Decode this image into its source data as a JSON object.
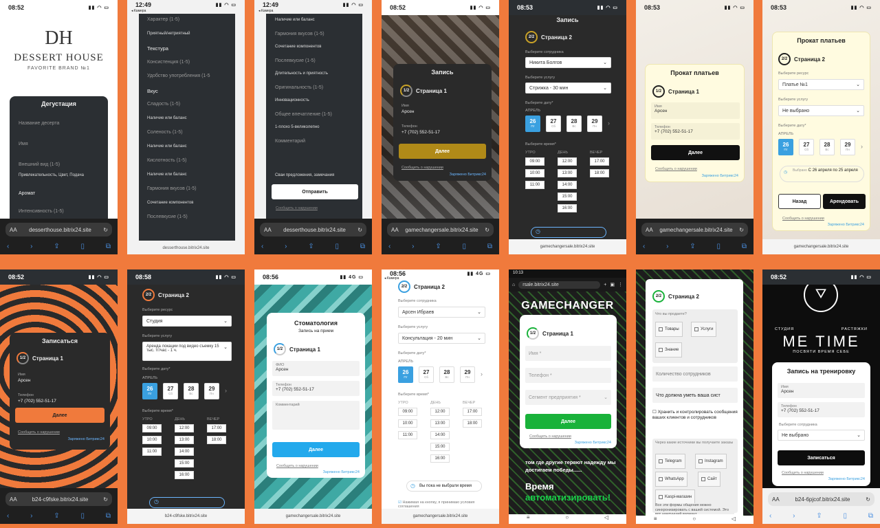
{
  "p1": {
    "time": "08:52",
    "logo_mono": "DH",
    "logo": "DESSERT HOUSE",
    "tag": "FAVORITE BRAND №1",
    "title": "Дегустация",
    "f1": "Название десерта",
    "f2": "Имя",
    "f3": "Внешний вид (1-5)",
    "f3s": "Привлекательность, Цвет, Подача",
    "f4": "Аромат",
    "f5": "Интенсивность (1-5)",
    "url": "desserthouse.bitrix24.site",
    "aa": "AA"
  },
  "p2": {
    "time": "12:49",
    "cam": "◂ Камера",
    "items": [
      "Характер (1-5)",
      "Приятный/нетриятный",
      "Текстура",
      "Консистенция (1-5)",
      "Удобство употребления (1-5",
      "Вкус",
      "Сладость (1-5)",
      "Наличие или баланс",
      "Соленость (1-5)",
      "Наличие или баланс",
      "Кислотность (1-5)",
      "Наличие или баланс",
      "Гармония вкусов (1-5)",
      "Сочетание компонентов",
      "Послевкусие (1-5)"
    ],
    "url": "desserthouse.bitrix24.site"
  },
  "p3": {
    "time": "12:49",
    "cam": "◂ Камера",
    "items": [
      "Наличие или баланс",
      "Гармония вкусов (1-5)",
      "Сочетание компонентов",
      "Послевкусие (1-5)",
      "Длительность и приятность",
      "Оригинальность (1-5)",
      "Инновационность",
      "Общее впечатление (1-5)",
      "1-плохо 5-великолепно",
      "Комментарий"
    ],
    "sug": "Сваи предложения, замечания",
    "send": "Отправить",
    "report": "Сообщить о нарушении",
    "url": "desserthouse.bitrix24.site",
    "aa": "AA"
  },
  "p4": {
    "time": "08:52",
    "title": "Запись",
    "ring": "1/2",
    "page": "Страница 1",
    "lname": "Имя",
    "name": "Арсен",
    "lphone": "Телефон",
    "phone": "+7 (702) 552-51-17",
    "next": "Далее",
    "report": "Сообщить о нарушении",
    "bx": "Заряжено Битрикс24",
    "url": "gamechangersale.bitrix24.site",
    "aa": "AA"
  },
  "p5": {
    "time": "08:53",
    "title": "Запись",
    "ring": "2/2",
    "page": "Страница 2",
    "l1": "Выберите сотрудника",
    "v1": "Никита Болгов",
    "l2": "Выберите услугу",
    "v2": "Стрижка - 30 мин",
    "l3": "Выберите дату*",
    "month": "АПРЕЛЬ",
    "dates": [
      [
        "26",
        "Пт"
      ],
      [
        "27",
        "Сб"
      ],
      [
        "28",
        "Вс"
      ],
      [
        "29",
        "Пн"
      ]
    ],
    "l4": "Выберите время*",
    "cols": [
      "УТРО",
      "ДЕНЬ",
      "ВЕЧЕР"
    ],
    "morning": [
      "09:00",
      "10:00",
      "11:00"
    ],
    "day": [
      "12:00",
      "13:00",
      "14:00",
      "15:00",
      "16:00"
    ],
    "evening": [
      "17:00",
      "18:00"
    ],
    "url": "gamechangersale.bitrix24.site"
  },
  "p6": {
    "time": "08:53",
    "title": "Прокат платьев",
    "ring": "1/2",
    "page": "Страница 1",
    "lname": "Имя",
    "name": "Арсен",
    "lphone": "Телефон",
    "phone": "+7 (702) 552-51-17",
    "next": "Далее",
    "report": "Сообщить о нарушении",
    "bx": "Заряжено Битрикс24",
    "url": "gamechangersale.bitrix24.site",
    "aa": "AA"
  },
  "p7": {
    "time": "08:53",
    "title": "Прокат платьев",
    "ring": "2/2",
    "page": "Страница 2",
    "l1": "Выберите ресурс",
    "v1": "Платье №1",
    "l2": "Выберите услугу",
    "v2": "Не выбрано",
    "l3": "Выберите дату*",
    "month": "АПРЕЛЬ",
    "dates": [
      [
        "26",
        "Пт"
      ],
      [
        "27",
        "Сб"
      ],
      [
        "28",
        "Вс"
      ],
      [
        "29",
        "Пн"
      ]
    ],
    "chosen_l": "Выбрано",
    "chosen": "С 26 апреля по 25 апреля",
    "back": "Назад",
    "rent": "Арендовать",
    "report": "Сообщить о нарушении",
    "bx": "Заряжено Битрикс24",
    "url": "gamechangersale.bitrix24.site"
  },
  "p8": {
    "time": "08:52",
    "title": "Записаться",
    "ring": "1/2",
    "page": "Страница 1",
    "lname": "Имя",
    "name": "Арсен",
    "lphone": "Телефон",
    "phone": "+7 (702) 552-51-17",
    "next": "Далее",
    "report": "Сообщить о нарушении",
    "bx": "Заряжено Битрикс24",
    "url": "b24-c9fske.bitrix24.site",
    "aa": "AA"
  },
  "p9": {
    "time": "08:58",
    "ring": "2/2",
    "page": "Страница 2",
    "l1": "Выберите ресурс",
    "v1": "Студия",
    "l2": "Выберите услугу",
    "v2": "Аренда локации под видео съемку 15 тыс. тг/час - 1 ч.",
    "l3": "Выберите дату*",
    "month": "АПРЕЛЬ",
    "dates": [
      [
        "26",
        "Пт"
      ],
      [
        "27",
        "Сб"
      ],
      [
        "28",
        "Вс"
      ],
      [
        "29",
        "Пн"
      ]
    ],
    "l4": "Выберите время*",
    "cols": [
      "УТРО",
      "ДЕНЬ",
      "ВЕЧЕР"
    ],
    "morning": [
      "09:00",
      "10:00",
      "11:00"
    ],
    "day": [
      "12:00",
      "13:00",
      "14:00",
      "15:00",
      "16:00"
    ],
    "evening": [
      "17:00",
      "18:00"
    ],
    "url": "b24-c9fske.bitrix24.site"
  },
  "p10": {
    "time": "08:56",
    "net": "4G",
    "title": "Стоматология",
    "sub": "Запись на прием",
    "ring": "1/2",
    "page": "Страница 1",
    "lname": "ФИО",
    "name": "Арсен",
    "lphone": "Телефон",
    "phone": "+7 (702) 552-51-17",
    "comment": "Комментарий",
    "next": "Далее",
    "report": "Сообщить о нарушении",
    "bx": "Заряжено Битрикс24",
    "url": "gamechangersale.bitrix24.site"
  },
  "p11": {
    "time": "08:56",
    "net": "4G",
    "cam": "◂ Камера",
    "ring": "2/2",
    "page": "Страница 2",
    "l1": "Выберите сотрудника",
    "v1": "Арсен Ибраев",
    "l2": "Выберите услугу",
    "v2": "Консультация - 20 мин",
    "l3": "Выберите дату*",
    "month": "АПРЕЛЬ",
    "dates": [
      [
        "26",
        "Пт"
      ],
      [
        "27",
        "Сб"
      ],
      [
        "28",
        "Вс"
      ],
      [
        "29",
        "Пн"
      ]
    ],
    "l4": "Выберите время*",
    "cols": [
      "УТРО",
      "ДЕНЬ",
      "ВЕЧЕР"
    ],
    "morning": [
      "09:00",
      "10:00",
      "11:00"
    ],
    "day": [
      "12:00",
      "13:00",
      "14:00",
      "15:00",
      "16:00"
    ],
    "evening": [
      "17:00",
      "18:00"
    ],
    "notime": "Вы пока не выбрали время",
    "agree": "Нажимая на кнопку, я принимаю условия соглашения",
    "url": "gamechangersale.bitrix24.site"
  },
  "p12": {
    "time": "10:13",
    "url": "rsale.bitrix24.site",
    "logo": "GAMECHANGER",
    "ring": "1/2",
    "page": "Страница 1",
    "f1": "Имя *",
    "f2": "Телефон *",
    "f3": "Сегмент предприятия *",
    "next": "Далее",
    "report": "Сообщить о нарушении",
    "bx": "Заряжено Битрикс24",
    "t1": "том где другие теряют надежду мы достигаем победы......",
    "t2": "Время",
    "t3": "автоматизировать!"
  },
  "p13": {
    "ring": "2/2",
    "page": "Страница 2",
    "l1": "Что вы продаете?",
    "opts": [
      "Товары",
      "Услуги",
      "Знание"
    ],
    "f1": "Количество сотрудников",
    "f2": "Что должна уметь ваша сист",
    "chk": "Хранить и контролировать сообщения ваших клиентов и сотрудников",
    "l2": "Через какие источники вы получаете заказы",
    "src": [
      "Telegram",
      "Instagram",
      "WhatsApp",
      "Сайт",
      "Kaspi-магазин"
    ],
    "note": "Все эти формы общения можно синхронизировать с вашей системой. Это вот наилучший вариант"
  },
  "p14": {
    "time": "08:52",
    "studio": "СТУДИЯ",
    "stretch": "РАСТЯЖКИ",
    "logo": "ME TIME",
    "slogan": "ПОСВЯТИ ВРЕМЯ СЕБЕ",
    "title": "Запись на тренировку",
    "lname": "Имя",
    "name": "Арсен",
    "lphone": "Телефон",
    "phone": "+7 (702) 552-51-17",
    "l3": "Выберите сотрудника",
    "v3": "Не выбрано",
    "submit": "Записаться",
    "report": "Сообщить о нарушении",
    "bx": "Заряжено Битрикс24",
    "url": "b24-6pjcof.bitrix24.site",
    "aa": "AA"
  }
}
